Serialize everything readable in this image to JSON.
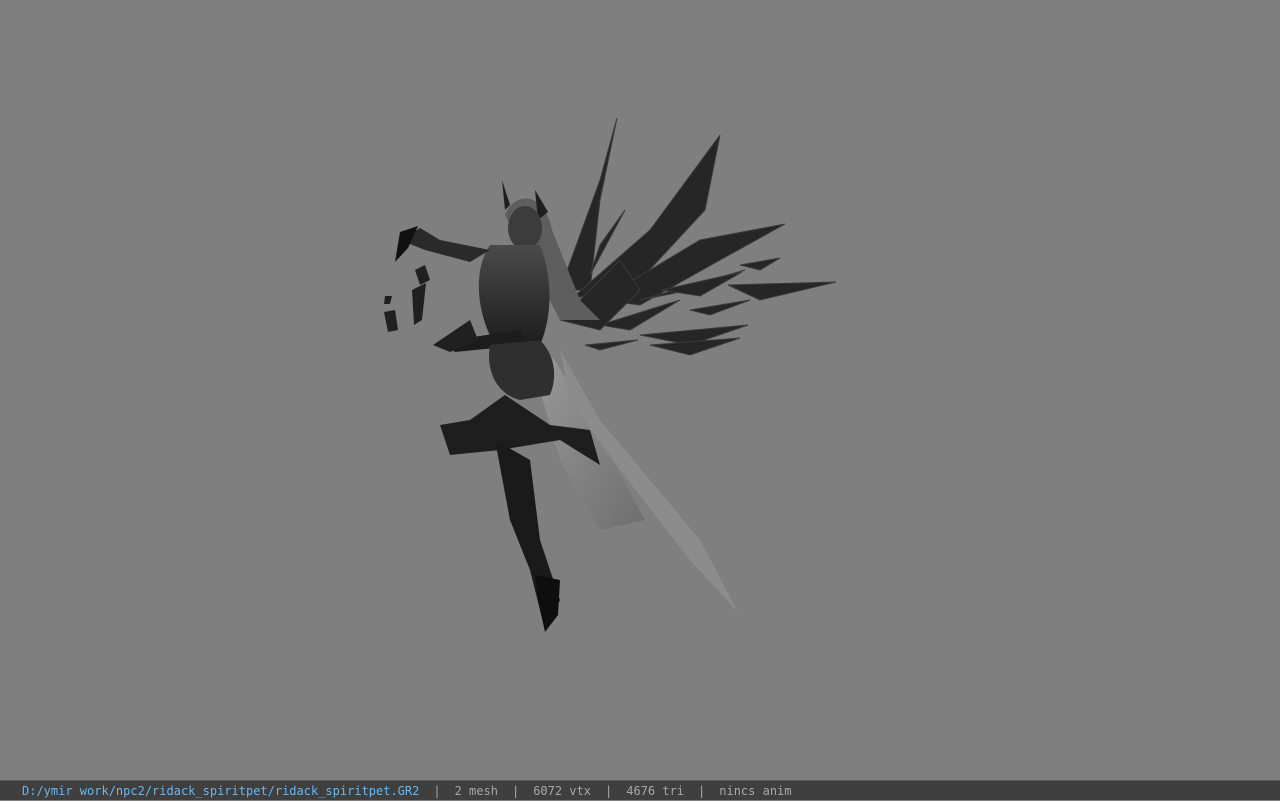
{
  "viewer": {
    "background_color": "#7f7f7f",
    "model_name": "ridack_spiritpet"
  },
  "statusbar": {
    "file_path": "D:/ymir work/npc2/ridack_spiritpet/ridack_spiritpet.GR2",
    "separator": "|",
    "mesh_count": "2 mesh",
    "vertex_count": "6072 vtx",
    "triangle_count": "4676 tri",
    "anim_status": "nincs anim",
    "path_color": "#66b7f2",
    "text_color": "#a7a7a7"
  }
}
